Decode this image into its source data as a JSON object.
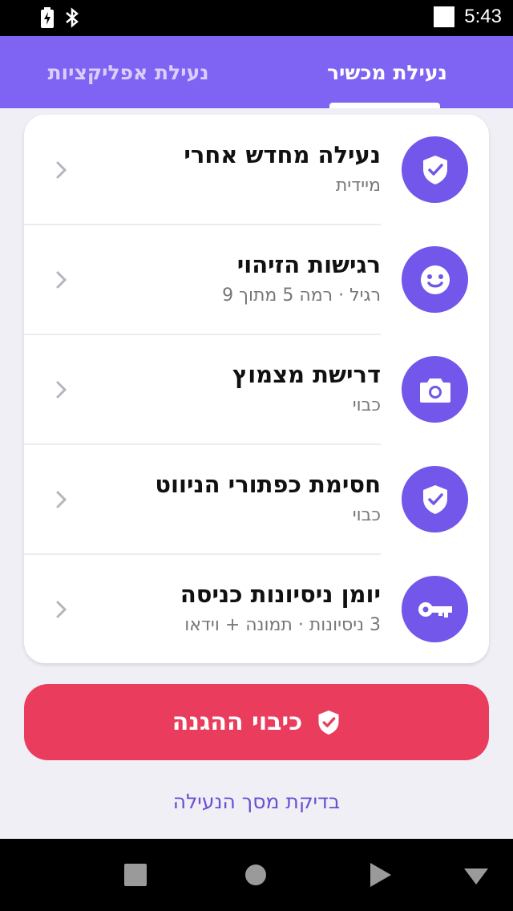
{
  "status_bar": {
    "time": "5:43",
    "icons": [
      "battery-charging-icon",
      "bluetooth-icon",
      "notification-icon"
    ]
  },
  "tabs": [
    {
      "label": "נעילת מכשיר",
      "selected": true
    },
    {
      "label": "נעילת אפליקציות",
      "selected": false
    }
  ],
  "settings": [
    {
      "icon": "shield-check-icon",
      "title": "נעילה מחדש אחרי",
      "subtitle": "מיידית"
    },
    {
      "icon": "face-icon",
      "title": "רגישות הזיהוי",
      "subtitle": "רגיל · רמה 5 מתוך 9"
    },
    {
      "icon": "camera-icon",
      "title": "דרישת מצמוץ",
      "subtitle": "כבוי"
    },
    {
      "icon": "shield-check-icon",
      "title": "חסימת כפתורי הניווט",
      "subtitle": "כבוי"
    },
    {
      "icon": "key-icon",
      "title": "יומן ניסיונות כניסה",
      "subtitle": "3 ניסיונות · תמונה + וידאו"
    }
  ],
  "protect_button": {
    "label": "כיבוי ההגנה",
    "icon": "shield-check-icon",
    "color": "#ea3c5c"
  },
  "lock_screen_link": "בדיקת מסך הנעילה",
  "colors": {
    "accent": "#7f63f2",
    "icon_bg": "#7356ea"
  },
  "nav_bar": [
    "recents-button",
    "home-button",
    "back-button",
    "notification-down-button"
  ]
}
